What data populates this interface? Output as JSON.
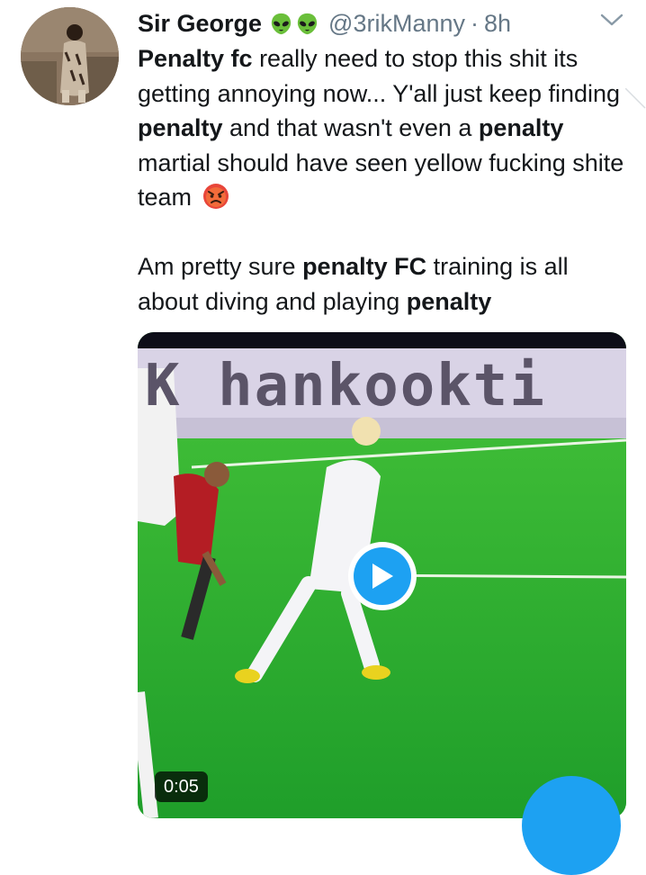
{
  "tweet": {
    "display_name": "Sir George",
    "handle": "@3rikManny",
    "separator": "·",
    "time": "8h",
    "paragraph1": [
      {
        "text": "Penalty fc",
        "bold": true
      },
      {
        "text": " really need to stop this shit its getting annoying now... Y'all just keep finding ",
        "bold": false
      },
      {
        "text": "penalty",
        "bold": true
      },
      {
        "text": " and that wasn't even a ",
        "bold": false
      },
      {
        "text": "penalty",
        "bold": true
      },
      {
        "text": " martial should have seen yellow fucking shite team ",
        "bold": false
      }
    ],
    "paragraph2": [
      {
        "text": "Am pretty sure ",
        "bold": false
      },
      {
        "text": "penalty FC",
        "bold": true
      },
      {
        "text": " training is all about diving and playing ",
        "bold": false
      },
      {
        "text": "penalty",
        "bold": true
      }
    ]
  },
  "media": {
    "banner_text": "K hankookti",
    "duration": "0:05"
  },
  "icons": {
    "name_emojis": [
      "alien-emoji",
      "alien-emoji"
    ],
    "text_emoji": "angry-face-emoji",
    "menu": "chevron-down-icon",
    "play": "play-icon",
    "compose": "compose-fab"
  },
  "colors": {
    "accent": "#1da1f2",
    "text": "#14171a",
    "muted": "#657786",
    "pitch": "#27ae2e"
  }
}
